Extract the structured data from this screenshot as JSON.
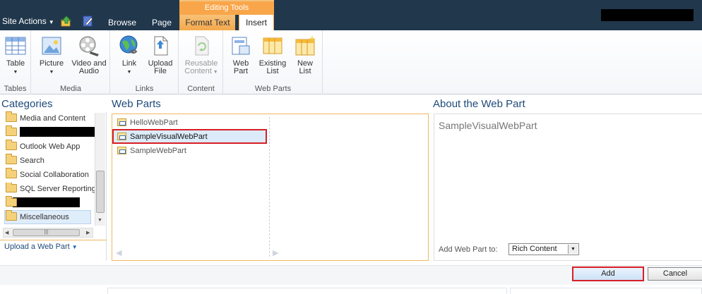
{
  "topbar": {
    "site_actions": "Site Actions",
    "tabs": {
      "browse": "Browse",
      "page": "Page",
      "format_text": "Format Text",
      "insert": "Insert"
    },
    "context_group": "Editing Tools"
  },
  "ribbon": {
    "groups": {
      "tables": "Tables",
      "media": "Media",
      "links": "Links",
      "content": "Content",
      "web_parts": "Web Parts"
    },
    "buttons": {
      "table": "Table",
      "picture": "Picture",
      "video_audio_1": "Video and",
      "video_audio_2": "Audio",
      "link": "Link",
      "upload_1": "Upload",
      "upload_2": "File",
      "reusable_1": "Reusable",
      "reusable_2": "Content",
      "webpart_1": "Web",
      "webpart_2": "Part",
      "existing_1": "Existing",
      "existing_2": "List",
      "newlist_1": "New",
      "newlist_2": "List"
    }
  },
  "categories": {
    "title": "Categories",
    "items": [
      "Media and Content",
      "",
      "Outlook Web App",
      "Search",
      "Social Collaboration",
      "SQL Server Reporting",
      "",
      "Miscellaneous"
    ],
    "selected": "Miscellaneous",
    "upload_link": "Upload a Web Part"
  },
  "webparts": {
    "title": "Web Parts",
    "items": [
      "HelloWebPart",
      "SampleVisualWebPart",
      "SampleWebPart"
    ],
    "selected": "SampleVisualWebPart"
  },
  "about": {
    "title": "About the Web Part",
    "name": "SampleVisualWebPart",
    "add_to_label": "Add Web Part to:",
    "zone": "Rich Content"
  },
  "footer": {
    "add": "Add",
    "cancel": "Cancel"
  }
}
